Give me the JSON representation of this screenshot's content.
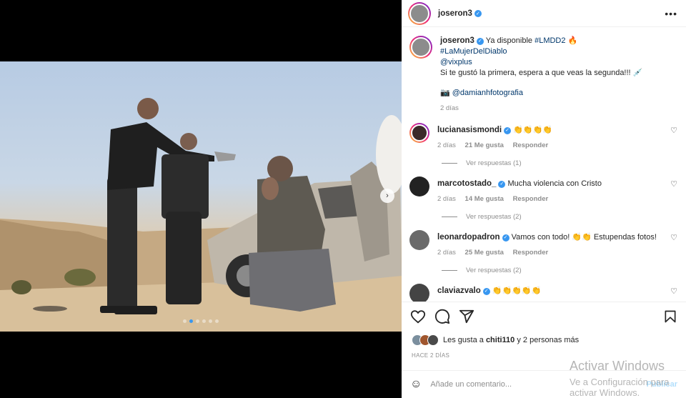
{
  "post": {
    "username": "joseron3",
    "caption": {
      "line1_text": "Ya disponible ",
      "line1_tag": "#LMDD2",
      "line1_emoji": "🔥",
      "line2_tag": "#LaMujerDelDiablo",
      "line3_tag": "@vixplus",
      "line4": "Si te gustó la primera, espera a que veas la segunda!!! 💉",
      "line5_emoji": "📷",
      "line5_tag": "@damianhfotografia",
      "time": "2 días"
    },
    "comments": [
      {
        "username": "lucianasismondi",
        "text": "👏👏👏👏",
        "time": "2 días",
        "likes": "21 Me gusta",
        "reply_label": "Responder",
        "replies_label": "Ver respuestas (1)",
        "avatar_color": "#3a2a2a"
      },
      {
        "username": "marcotostado_",
        "text": "Mucha violencia con Cristo",
        "time": "2 días",
        "likes": "14 Me gusta",
        "reply_label": "Responder",
        "replies_label": "Ver respuestas (2)",
        "avatar_color": "#222222"
      },
      {
        "username": "leonardopadron",
        "text": "Vamos con todo! 👏👏 Estupendas fotos!",
        "time": "2 días",
        "likes": "25 Me gusta",
        "reply_label": "Responder",
        "replies_label": "Ver respuestas (2)",
        "avatar_color": "#6a6a6a"
      },
      {
        "username": "claviazvalo",
        "text": "👏👏👏👏👏",
        "avatar_color": "#444444"
      }
    ],
    "likes": {
      "prefix": "Les gusta a ",
      "user": "chiti110",
      "suffix": " y 2 personas más"
    },
    "posted_ago": "HACE 2 DÍAS",
    "comment_placeholder": "Añade un comentario...",
    "publish_label": "Publicar",
    "icons": {
      "like": "heart-icon",
      "comment": "comment-icon",
      "share": "share-icon",
      "save": "bookmark-icon",
      "emoji": "emoji-icon",
      "more": "more-options-icon",
      "next": "chevron-right-icon"
    },
    "carousel": {
      "count": 6,
      "active": 1
    }
  },
  "colors": {
    "link": "#00376b",
    "verified": "#3897f0",
    "muted": "#8e8e8e"
  },
  "watermark": {
    "line1": "Activar Windows",
    "line2": "Ve a Configuración para activar Windows."
  }
}
